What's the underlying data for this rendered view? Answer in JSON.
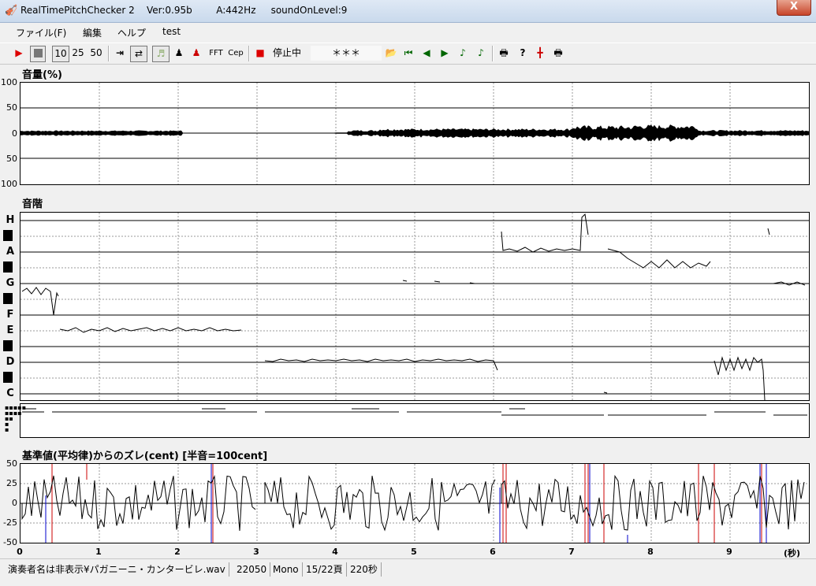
{
  "window": {
    "title": "RealTimePitchChecker 2    Ver:0.95b        A:442Hz     soundOnLevel:9",
    "close_label": "X"
  },
  "menu": [
    "ファイル(F)",
    "編集",
    "ヘルプ",
    "test"
  ],
  "toolbar": {
    "rate_buttons": [
      "10",
      "25",
      "50"
    ],
    "fft_label": "FFT",
    "cep_label": "Cep",
    "status_text": "停止中",
    "marker_text": "＊＊＊"
  },
  "volume_panel": {
    "label": "音量(%)",
    "y_ticks": [
      "100",
      "50",
      "0",
      "50",
      "100"
    ]
  },
  "scale_panel": {
    "label": "音階",
    "notes": [
      "H",
      "A",
      "G",
      "F",
      "E",
      "D",
      "C"
    ]
  },
  "cent_panel": {
    "label": "基準値(平均律)からのズレ(cent) [半音=100cent]",
    "y_ticks": [
      "50",
      "25",
      "0",
      "-25",
      "-50"
    ],
    "x_ticks": [
      "0",
      "1",
      "2",
      "3",
      "4",
      "5",
      "6",
      "7",
      "8",
      "9"
    ],
    "x_unit": "(秒)"
  },
  "colors": {
    "accent_red": "#cc0000",
    "blue": "#0000cc",
    "line": "#000000"
  },
  "status": {
    "file": "演奏者名は非表示¥パガニーニ・カンタービレ.wav",
    "rate": "22050",
    "channels": "Mono",
    "page": "15/22頁",
    "duration": "220秒"
  }
}
